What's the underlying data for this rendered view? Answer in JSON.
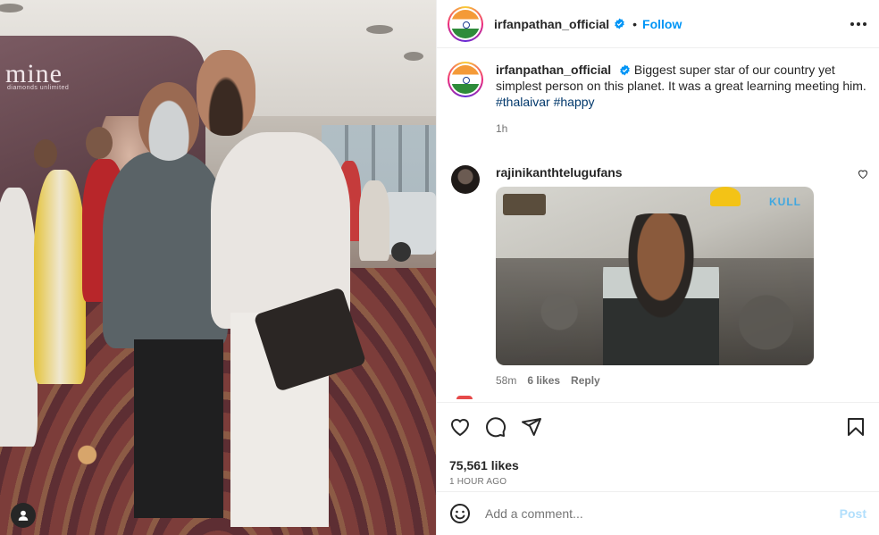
{
  "post": {
    "username": "irfanpathan_official",
    "follow_label": "Follow",
    "dot": "•",
    "caption": "Biggest super star of our country yet simplest person on this planet. It was a great learning meeting him.",
    "hashtags": "#thalaivar #happy",
    "caption_time": "1h",
    "billboard_brand": "mine",
    "billboard_sub": "diamonds unlimited"
  },
  "comment": {
    "username": "rajinikanthtelugufans",
    "gif_watermark": "KULL",
    "time": "58m",
    "likes": "6 likes",
    "reply_label": "Reply"
  },
  "footer": {
    "likes": "75,561 likes",
    "time_ago": "1 hour ago",
    "comment_placeholder": "Add a comment...",
    "post_label": "Post"
  },
  "colors": {
    "accent": "#0095f6",
    "post_disabled": "#b2dffc",
    "hashtag": "#00376b"
  }
}
